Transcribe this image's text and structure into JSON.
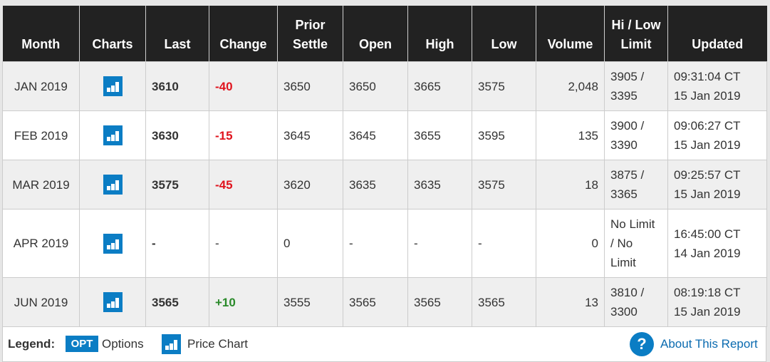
{
  "table": {
    "headers": {
      "month": "Month",
      "charts": "Charts",
      "last": "Last",
      "change": "Change",
      "prior_settle_1": "Prior",
      "prior_settle_2": "Settle",
      "open": "Open",
      "high": "High",
      "low": "Low",
      "volume": "Volume",
      "limit_1": "Hi / Low",
      "limit_2": "Limit",
      "updated": "Updated"
    },
    "rows": [
      {
        "month": "JAN 2019",
        "chart_icon": "bar-chart-icon",
        "last": "3610",
        "change": "-40",
        "change_dir": "neg",
        "prior_settle": "3650",
        "open": "3650",
        "high": "3665",
        "low": "3575",
        "volume": "2,048",
        "limit_1": "3905 /",
        "limit_2": "3395",
        "limit_3": "",
        "updated_time": "09:31:04 CT",
        "updated_date": "15 Jan 2019"
      },
      {
        "month": "FEB 2019",
        "chart_icon": "bar-chart-icon",
        "last": "3630",
        "change": "-15",
        "change_dir": "neg",
        "prior_settle": "3645",
        "open": "3645",
        "high": "3655",
        "low": "3595",
        "volume": "135",
        "limit_1": "3900 /",
        "limit_2": "3390",
        "limit_3": "",
        "updated_time": "09:06:27 CT",
        "updated_date": "15 Jan 2019"
      },
      {
        "month": "MAR 2019",
        "chart_icon": "bar-chart-icon",
        "last": "3575",
        "change": "-45",
        "change_dir": "neg",
        "prior_settle": "3620",
        "open": "3635",
        "high": "3635",
        "low": "3575",
        "volume": "18",
        "limit_1": "3875 /",
        "limit_2": "3365",
        "limit_3": "",
        "updated_time": "09:25:57 CT",
        "updated_date": "15 Jan 2019"
      },
      {
        "month": "APR 2019",
        "chart_icon": "bar-chart-icon",
        "last": "-",
        "change": "-",
        "change_dir": "none",
        "prior_settle": "0",
        "open": "-",
        "high": "-",
        "low": "-",
        "volume": "0",
        "limit_1": "No Limit",
        "limit_2": "/ No",
        "limit_3": "Limit",
        "updated_time": "16:45:00 CT",
        "updated_date": "14 Jan 2019"
      },
      {
        "month": "JUN 2019",
        "chart_icon": "bar-chart-icon",
        "last": "3565",
        "change": "+10",
        "change_dir": "pos",
        "prior_settle": "3555",
        "open": "3565",
        "high": "3565",
        "low": "3565",
        "volume": "13",
        "limit_1": "3810 /",
        "limit_2": "3300",
        "limit_3": "",
        "updated_time": "08:19:18 CT",
        "updated_date": "15 Jan 2019"
      }
    ]
  },
  "legend": {
    "label": "Legend:",
    "opt_badge": "OPT",
    "opt_label": "Options",
    "chart_label": "Price Chart",
    "help_icon": "?",
    "about_link": "About This Report"
  },
  "colors": {
    "header_bg": "#222222",
    "accent_blue": "#0b7dc4",
    "negative": "#e0141e",
    "positive": "#2a8a2a",
    "row_alt": "#efefef"
  }
}
